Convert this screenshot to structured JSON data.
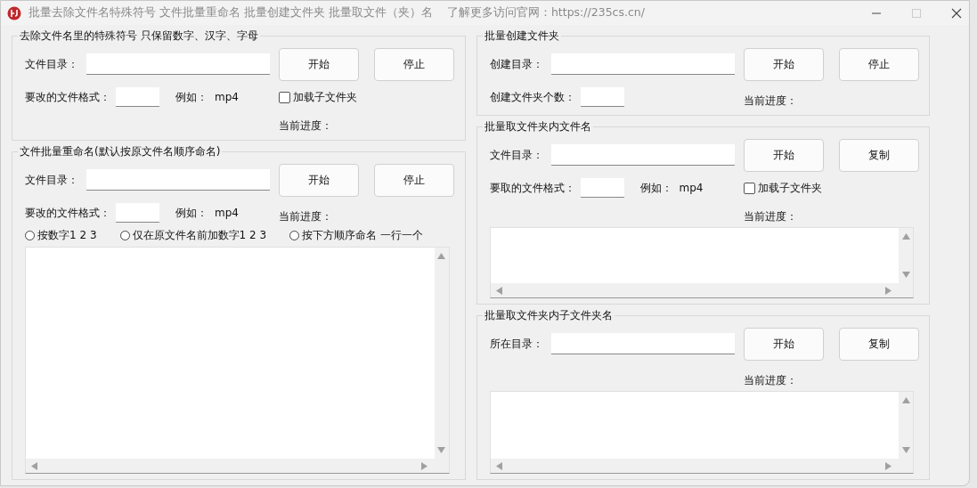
{
  "window": {
    "title": "批量去除文件名特殊符号 文件批量重命名 批量创建文件夹 批量取文件（夹）名",
    "site_note": "了解更多访问官网：https://235cs.cn/",
    "maximize_disabled": true
  },
  "columns": [
    {
      "groups": [
        {
          "title": "去除文件名里的特殊符号 只保留数字、汉字、字母",
          "rows": [
            {
              "left": [
                {
                  "kind": "label",
                  "text": "文件目录："
                },
                {
                  "kind": "path_input"
                }
              ],
              "mid": {
                "kind": "button",
                "text": "开始"
              },
              "right": {
                "kind": "button",
                "text": "停止"
              }
            },
            {
              "left": [
                {
                  "kind": "label",
                  "text": "要改的文件格式："
                },
                {
                  "kind": "short_input"
                },
                {
                  "kind": "example",
                  "text": "例如：",
                  "value": "mp4"
                }
              ],
              "mid": {
                "kind": "checkbox",
                "text": "加载子文件夹",
                "checked": false
              }
            },
            {
              "left": [],
              "mid": {
                "kind": "progress",
                "text": "当前进度："
              }
            }
          ]
        },
        {
          "title": "文件批量重命名(默认按原文件名顺序命名)",
          "rows": [
            {
              "left": [
                {
                  "kind": "label",
                  "text": "文件目录："
                },
                {
                  "kind": "path_input"
                }
              ],
              "mid": {
                "kind": "button",
                "text": "开始"
              },
              "right": {
                "kind": "button",
                "text": "停止"
              }
            },
            {
              "left": [
                {
                  "kind": "label",
                  "text": "要改的文件格式："
                },
                {
                  "kind": "short_input"
                },
                {
                  "kind": "example",
                  "text": "例如：",
                  "value": "mp4"
                }
              ],
              "mid": {
                "kind": "progress",
                "text": "当前进度："
              }
            },
            {
              "full": [
                {
                  "kind": "radio",
                  "text": "按数字1 2 3",
                  "selected": false
                },
                {
                  "kind": "radio",
                  "text": "仅在原文件名前加数字1 2 3",
                  "selected": false
                },
                {
                  "kind": "radio",
                  "text": "按下方顺序命名 一行一个",
                  "selected": false
                }
              ]
            }
          ],
          "output_box": {
            "kind": "textarea"
          }
        }
      ]
    },
    {
      "groups": [
        {
          "title": "批量创建文件夹",
          "rows": [
            {
              "left": [
                {
                  "kind": "label",
                  "text": "创建目录："
                },
                {
                  "kind": "path_input"
                }
              ],
              "mid": {
                "kind": "button",
                "text": "开始"
              },
              "right": {
                "kind": "button",
                "text": "停止"
              }
            },
            {
              "left": [
                {
                  "kind": "label",
                  "text": "创建文件夹个数："
                },
                {
                  "kind": "short_input"
                }
              ],
              "mid": {
                "kind": "progress",
                "text": "当前进度："
              }
            }
          ]
        },
        {
          "title": "批量取文件夹内文件名",
          "rows": [
            {
              "left": [
                {
                  "kind": "label",
                  "text": "文件目录："
                },
                {
                  "kind": "path_input"
                }
              ],
              "mid": {
                "kind": "button",
                "text": "开始"
              },
              "right": {
                "kind": "button",
                "text": "复制"
              }
            },
            {
              "left": [
                {
                  "kind": "label",
                  "text": "要取的文件格式："
                },
                {
                  "kind": "short_input"
                },
                {
                  "kind": "example",
                  "text": "例如：",
                  "value": "mp4"
                }
              ],
              "mid": {
                "kind": "checkbox",
                "text": "加载子文件夹",
                "checked": false
              }
            },
            {
              "left": [],
              "mid": {
                "kind": "progress",
                "text": "当前进度："
              }
            }
          ],
          "output_box": {
            "kind": "textarea"
          }
        },
        {
          "title": "批量取文件夹内子文件夹名",
          "rows": [
            {
              "left": [
                {
                  "kind": "label",
                  "text": "所在目录："
                },
                {
                  "kind": "path_input"
                }
              ],
              "mid": {
                "kind": "button",
                "text": "开始"
              },
              "right": {
                "kind": "button",
                "text": "复制"
              }
            },
            {
              "left": [],
              "mid": {
                "kind": "progress",
                "text": "当前进度："
              }
            }
          ],
          "output_box": {
            "kind": "textarea"
          }
        }
      ]
    }
  ]
}
